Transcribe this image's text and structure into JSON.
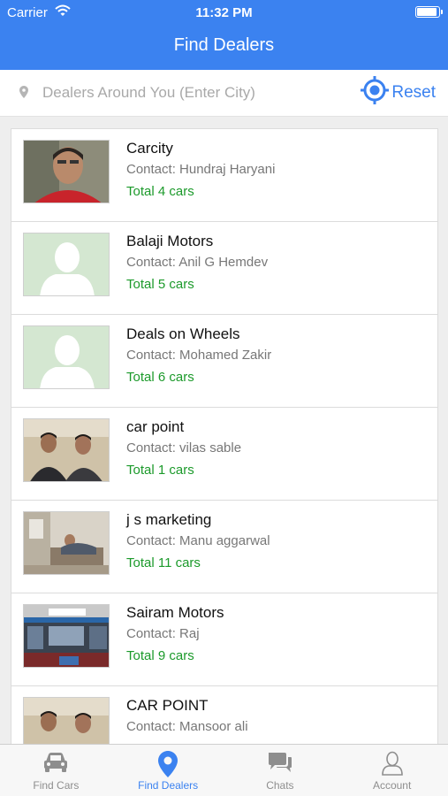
{
  "status_bar": {
    "carrier": "Carrier",
    "time": "11:32 PM"
  },
  "nav": {
    "title": "Find Dealers"
  },
  "search": {
    "placeholder": "Dealers Around You (Enter City)",
    "reset_label": "Reset"
  },
  "dealers": [
    {
      "name": "Carcity",
      "contact": "Contact: Hundraj Haryani",
      "total": "Total 4 cars",
      "photo": "person-photo"
    },
    {
      "name": "Balaji Motors",
      "contact": "Contact: Anil G Hemdev",
      "total": "Total 5 cars",
      "photo": "placeholder-avatar"
    },
    {
      "name": "Deals on Wheels",
      "contact": "Contact: Mohamed Zakir",
      "total": "Total 6 cars",
      "photo": "placeholder-avatar"
    },
    {
      "name": "car point",
      "contact": "Contact: vilas sable",
      "total": "Total 1 cars",
      "photo": "two-people-photo"
    },
    {
      "name": "j s marketing",
      "contact": "Contact: Manu aggarwal",
      "total": "Total 11 cars",
      "photo": "office-photo"
    },
    {
      "name": "Sairam Motors",
      "contact": "Contact: Raj",
      "total": "Total 9 cars",
      "photo": "shop-photo"
    },
    {
      "name": "CAR POINT",
      "contact": "Contact: Mansoor ali",
      "total": "",
      "photo": "two-people-photo"
    }
  ],
  "tabs": [
    {
      "label": "Find Cars",
      "icon": "car-icon",
      "active": false
    },
    {
      "label": "Find Dealers",
      "icon": "location-pin-icon",
      "active": true
    },
    {
      "label": "Chats",
      "icon": "chat-bubbles-icon",
      "active": false
    },
    {
      "label": "Account",
      "icon": "person-icon",
      "active": false
    }
  ],
  "colors": {
    "accent": "#3b82f0",
    "total_text": "#1c9a2b"
  }
}
